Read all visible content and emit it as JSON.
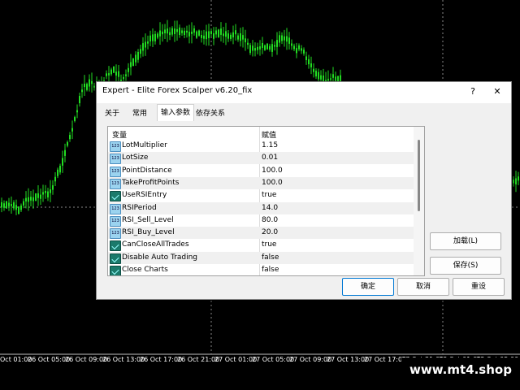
{
  "dialog": {
    "title": "Expert - Elite Forex Scalper v6.20_fix",
    "help_glyph": "?",
    "close_glyph": "✕"
  },
  "tabs": [
    {
      "label": "关于"
    },
    {
      "label": "常用"
    },
    {
      "label": "输入参数"
    },
    {
      "label": "依存关系"
    }
  ],
  "grid": {
    "col_name": "变量",
    "col_value": "赋值",
    "rows": [
      {
        "type": "num",
        "name": "LotMultiplier",
        "value": "1.15"
      },
      {
        "type": "num",
        "name": "LotSize",
        "value": "0.01"
      },
      {
        "type": "num",
        "name": "PointDistance",
        "value": "100.0"
      },
      {
        "type": "num",
        "name": "TakeProfitPoints",
        "value": "100.0"
      },
      {
        "type": "bool",
        "name": "UseRSIEntry",
        "value": "true"
      },
      {
        "type": "num",
        "name": "RSIPeriod",
        "value": "14.0"
      },
      {
        "type": "num",
        "name": "RSI_Sell_Level",
        "value": "80.0"
      },
      {
        "type": "num",
        "name": "RSI_Buy_Level",
        "value": "20.0"
      },
      {
        "type": "bool",
        "name": "CanCloseAllTrades",
        "value": "true"
      },
      {
        "type": "bool",
        "name": "Disable Auto Trading",
        "value": "false"
      },
      {
        "type": "bool",
        "name": "Close Charts",
        "value": "false"
      }
    ]
  },
  "buttons": {
    "load": "加载(L)",
    "save": "保存(S)",
    "ok": "确定",
    "cancel": "取消",
    "reset": "重设"
  },
  "time_axis": [
    "Oct 01:00",
    "26 Oct 05:00",
    "26 Oct 09:00",
    "26 Oct 13:00",
    "26 Oct 17:00",
    "26 Oct 21:00",
    "27 Oct 01:00",
    "27 Oct 05:00",
    "27 Oct 09:00",
    "27 Oct 13:00",
    "27 Oct 17:00",
    "27 Oct 21:00",
    "28 Oct 01:00",
    "28 Oct 05:00"
  ],
  "watermark": "www.mt4.shop",
  "colors": {
    "candles": "#22dd22",
    "background": "#000000",
    "accent": "#0078d4"
  },
  "series": [
    {
      "x": 0,
      "y": 255
    },
    {
      "x": 10,
      "y": 250
    },
    {
      "x": 20,
      "y": 258
    },
    {
      "x": 30,
      "y": 248
    },
    {
      "x": 40,
      "y": 246
    },
    {
      "x": 50,
      "y": 240
    },
    {
      "x": 60,
      "y": 238
    },
    {
      "x": 70,
      "y": 215
    },
    {
      "x": 80,
      "y": 185
    },
    {
      "x": 90,
      "y": 150
    },
    {
      "x": 100,
      "y": 110
    },
    {
      "x": 110,
      "y": 103
    },
    {
      "x": 120,
      "y": 110
    },
    {
      "x": 130,
      "y": 95
    },
    {
      "x": 140,
      "y": 85
    },
    {
      "x": 150,
      "y": 100
    },
    {
      "x": 160,
      "y": 80
    },
    {
      "x": 170,
      "y": 65
    },
    {
      "x": 180,
      "y": 50
    },
    {
      "x": 190,
      "y": 45
    },
    {
      "x": 200,
      "y": 42
    },
    {
      "x": 210,
      "y": 40
    },
    {
      "x": 220,
      "y": 38
    },
    {
      "x": 230,
      "y": 42
    },
    {
      "x": 240,
      "y": 40
    },
    {
      "x": 250,
      "y": 45
    },
    {
      "x": 260,
      "y": 42
    },
    {
      "x": 270,
      "y": 40
    },
    {
      "x": 280,
      "y": 44
    },
    {
      "x": 290,
      "y": 42
    },
    {
      "x": 300,
      "y": 50
    },
    {
      "x": 310,
      "y": 62
    },
    {
      "x": 320,
      "y": 58
    },
    {
      "x": 330,
      "y": 60
    },
    {
      "x": 340,
      "y": 52
    },
    {
      "x": 350,
      "y": 48
    },
    {
      "x": 360,
      "y": 58
    },
    {
      "x": 370,
      "y": 62
    },
    {
      "x": 380,
      "y": 75
    },
    {
      "x": 390,
      "y": 95
    },
    {
      "x": 400,
      "y": 100
    },
    {
      "x": 410,
      "y": 96
    },
    {
      "x": 420,
      "y": 100
    },
    {
      "x": 630,
      "y": 225
    },
    {
      "x": 640,
      "y": 215
    }
  ]
}
